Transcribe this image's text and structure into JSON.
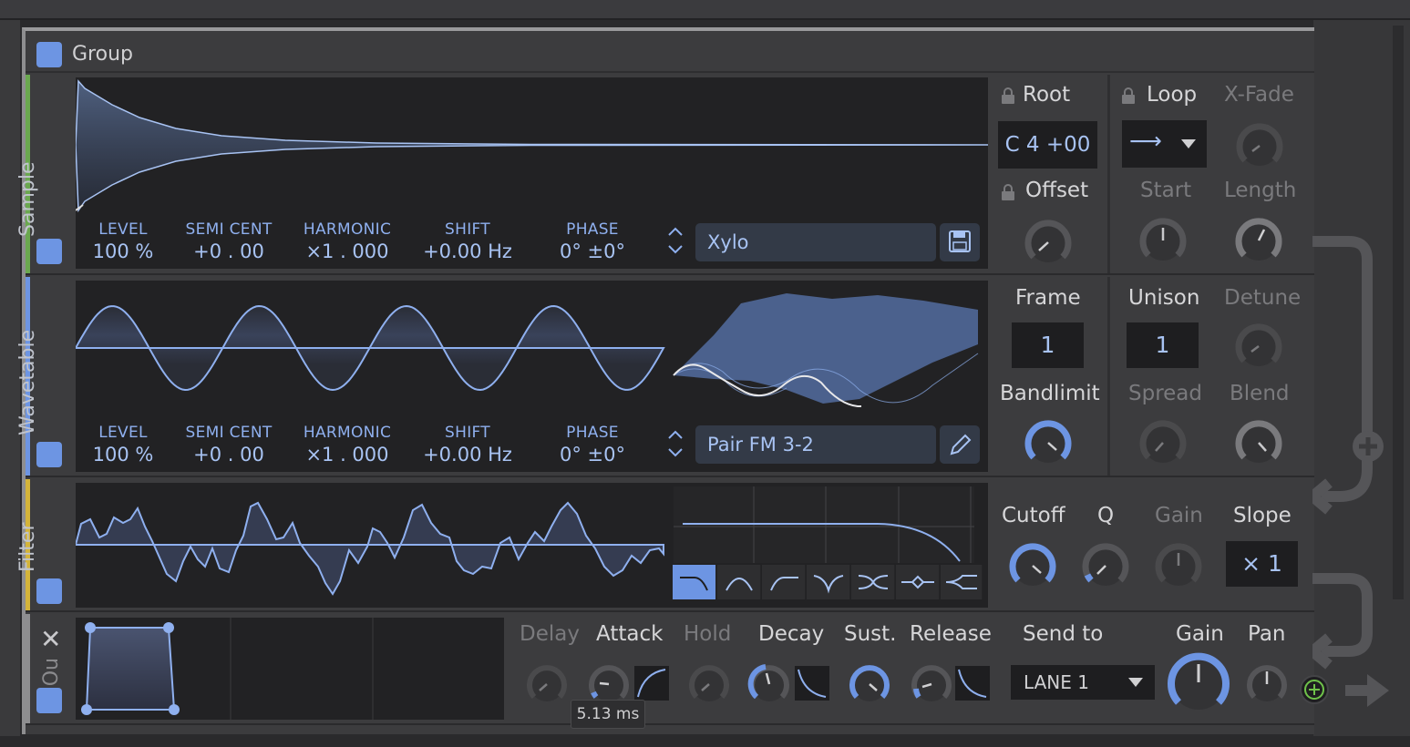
{
  "group": {
    "title": "Group"
  },
  "sample": {
    "title": "Sample",
    "params": [
      {
        "label": "LEVEL",
        "value": "100 %"
      },
      {
        "label": "SEMI CENT",
        "value": "+0 . 00"
      },
      {
        "label": "HARMONIC",
        "value": "×1 . 000"
      },
      {
        "label": "SHIFT",
        "value": "+0.00 Hz"
      },
      {
        "label": "PHASE",
        "value": "0° ±0°"
      }
    ],
    "preset": "Xylo",
    "root_label": "Root",
    "root_value": "C  4 +00",
    "offset_label": "Offset",
    "loop_label": "Loop",
    "loop_mode": "⟶",
    "xfade_label": "X-Fade",
    "start_label": "Start",
    "length_label": "Length"
  },
  "wavetable": {
    "title": "Wavetable",
    "params": [
      {
        "label": "LEVEL",
        "value": "100 %"
      },
      {
        "label": "SEMI CENT",
        "value": "+0 . 00"
      },
      {
        "label": "HARMONIC",
        "value": "×1 . 000"
      },
      {
        "label": "SHIFT",
        "value": "+0.00 Hz"
      },
      {
        "label": "PHASE",
        "value": "0° ±0°"
      }
    ],
    "preset": "Pair FM 3-2",
    "frame_label": "Frame",
    "frame_value": "1",
    "unison_label": "Unison",
    "unison_value": "1",
    "detune_label": "Detune",
    "bandlimit_label": "Bandlimit",
    "spread_label": "Spread",
    "blend_label": "Blend"
  },
  "filter": {
    "title": "Filter",
    "cutoff_label": "Cutoff",
    "q_label": "Q",
    "gain_label": "Gain",
    "slope_label": "Slope",
    "slope_value": "× 1"
  },
  "envelope": {
    "title": "Ou",
    "delay_label": "Delay",
    "attack_label": "Attack",
    "hold_label": "Hold",
    "decay_label": "Decay",
    "sustain_label": "Sust.",
    "release_label": "Release",
    "tooltip": "5.13 ms"
  },
  "output": {
    "send_label": "Send to",
    "lane": "LANE 1",
    "gain_label": "Gain",
    "pan_label": "Pan"
  },
  "colors": {
    "accent": "#6d95e3",
    "sample_stripe": "#6aa84f",
    "wavetable_stripe": "#6d95e3",
    "filter_stripe": "#d4b43a"
  }
}
